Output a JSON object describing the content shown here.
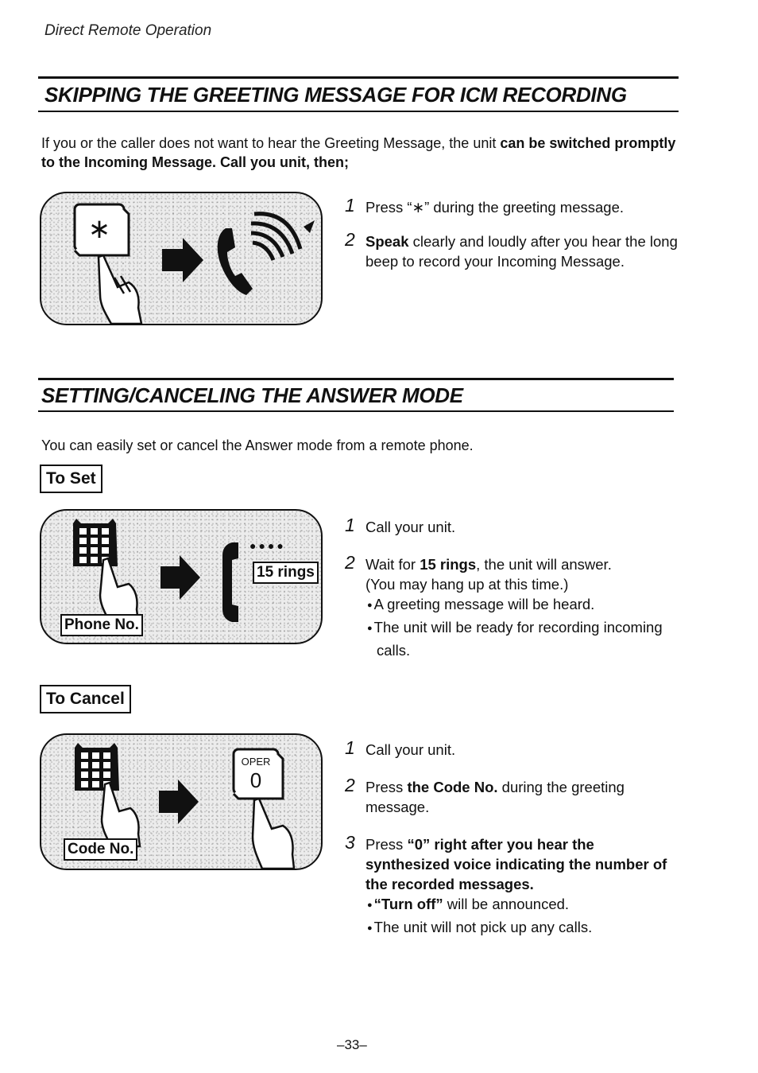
{
  "running_head": "Direct Remote Operation",
  "section1": {
    "title": "SKIPPING THE GREETING MESSAGE FOR ICM RECORDING",
    "intro_plain": "If you or the caller does not want to hear the Greeting Message, the unit ",
    "intro_bold": "can be switched promptly to the Incoming Message. Call you unit, then;",
    "illustration": {
      "icons": [
        "star-key-icon",
        "finger-press-icon",
        "arrow-right-icon",
        "handset-icon",
        "sound-waves-icon"
      ]
    },
    "steps": [
      {
        "num": "1",
        "pre": "Press “∗” during the greeting message.",
        "bold": "",
        "post": ""
      },
      {
        "num": "2",
        "pre": "",
        "bold": "Speak",
        "post": " clearly and loudly after you hear the long beep to record your Incoming Message."
      }
    ],
    "star_key_glyph": "∗"
  },
  "section2": {
    "title": "SETTING/CANCELING THE ANSWER MODE",
    "intro": "You can easily set or cancel the Answer mode from a remote phone.",
    "to_set": {
      "label": "To Set",
      "illustration": {
        "phone_label": "Phone No.",
        "rings_label": "15 rings",
        "dots": "●●●●"
      },
      "steps": [
        {
          "num": "1",
          "text": "Call your unit."
        },
        {
          "num": "2",
          "pre": "Wait for ",
          "bold": "15 rings",
          "post": ", the unit will answer.",
          "line2": "(You may hang up at this time.)",
          "bullets": [
            "A greeting message will be heard.",
            "The unit will be ready for recording incoming calls."
          ]
        }
      ]
    },
    "to_cancel": {
      "label": "To Cancel",
      "illustration": {
        "code_label": "Code No.",
        "key_top": "OPER",
        "key_digit": "0"
      },
      "steps": [
        {
          "num": "1",
          "text": "Call your unit."
        },
        {
          "num": "2",
          "pre": "Press ",
          "bold": "the Code No.",
          "post": " during the greeting message."
        },
        {
          "num": "3",
          "pre": "Press ",
          "bold": "“0” right after you hear the synthesized voice indicating the number of the recorded messages.",
          "bullets_rich": [
            {
              "bold": "“Turn off”",
              "text": " will be announced."
            },
            {
              "bold": "",
              "text": "The unit will not pick up any calls."
            }
          ]
        }
      ]
    }
  },
  "page_number": "–33–"
}
